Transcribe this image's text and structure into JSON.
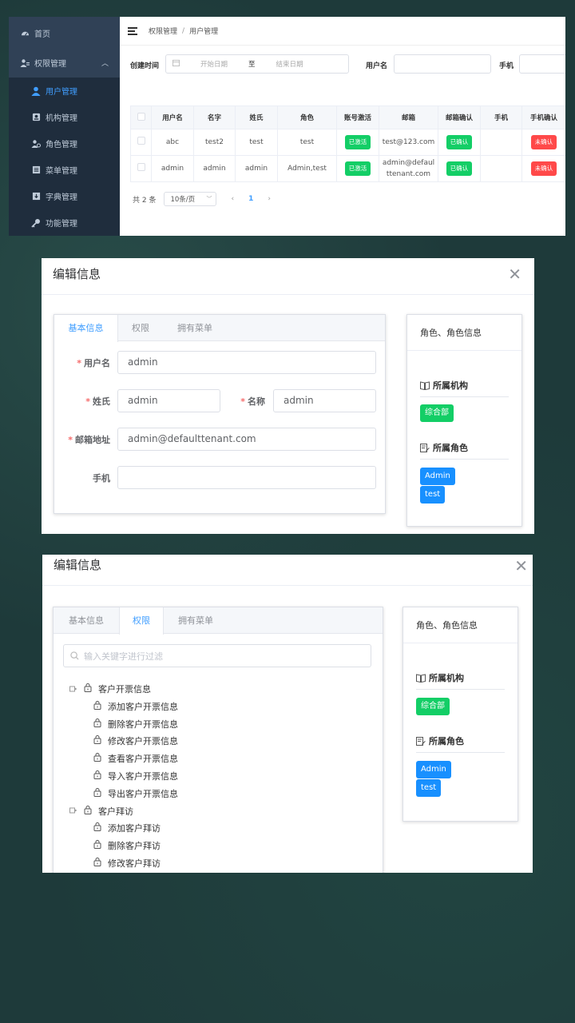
{
  "panel1": {
    "sidebar": {
      "home": "首页",
      "group": "权限管理",
      "items": [
        "用户管理",
        "机构管理",
        "角色管理",
        "菜单管理",
        "字典管理",
        "功能管理"
      ]
    },
    "breadcrumb": [
      "权限管理",
      "用户管理"
    ],
    "filter": {
      "created_label": "创建时间",
      "start_placeholder": "开始日期",
      "range_sep": "至",
      "end_placeholder": "结束日期",
      "username_label": "用户名",
      "phone_label": "手机"
    },
    "table": {
      "columns": [
        "用户名",
        "名字",
        "姓氏",
        "角色",
        "账号激活",
        "邮箱",
        "邮箱确认",
        "手机",
        "手机确认"
      ],
      "rows": [
        {
          "username": "abc",
          "first": "test2",
          "last": "test",
          "role": "test",
          "active": "已激活",
          "email": "test@123.com",
          "email_confirm": "已确认",
          "phone": "",
          "phone_confirm": "未确认"
        },
        {
          "username": "admin",
          "first": "admin",
          "last": "admin",
          "role": "Admin,test",
          "active": "已激活",
          "email_line1": "admin@defaul",
          "email_line2": "ttenant.com",
          "email_confirm": "已确认",
          "phone": "",
          "phone_confirm": "未确认"
        }
      ]
    },
    "pager": {
      "total": "共 2 条",
      "size": "10条/页",
      "current": "1"
    }
  },
  "dialog": {
    "title": "编辑信息",
    "tabs": [
      "基本信息",
      "权限",
      "拥有菜单"
    ],
    "form": {
      "username_label": "用户名",
      "username": "admin",
      "surname_label": "姓氏",
      "surname": "admin",
      "name_label": "名称",
      "name": "admin",
      "email_label": "邮箱地址",
      "email": "admin@defaulttenant.com",
      "phone_label": "手机",
      "phone": ""
    },
    "side": {
      "title": "角色、角色信息",
      "org_label": "所属机构",
      "org": "综合部",
      "role_label": "所属角色",
      "roles": [
        "Admin",
        "test"
      ]
    },
    "perm": {
      "search_placeholder": "输入关键字进行过滤",
      "tree": [
        {
          "label": "客户开票信息",
          "children": [
            "添加客户开票信息",
            "删除客户开票信息",
            "修改客户开票信息",
            "查看客户开票信息",
            "导入客户开票信息",
            "导出客户开票信息"
          ]
        },
        {
          "label": "客户拜访",
          "children": [
            "添加客户拜访",
            "删除客户拜访",
            "修改客户拜访"
          ]
        }
      ]
    }
  },
  "colors": {
    "accent": "#409eff",
    "success": "#13ce66",
    "danger": "#ff4949",
    "sidebar": "#304156",
    "role_tag": "#1890ff"
  }
}
